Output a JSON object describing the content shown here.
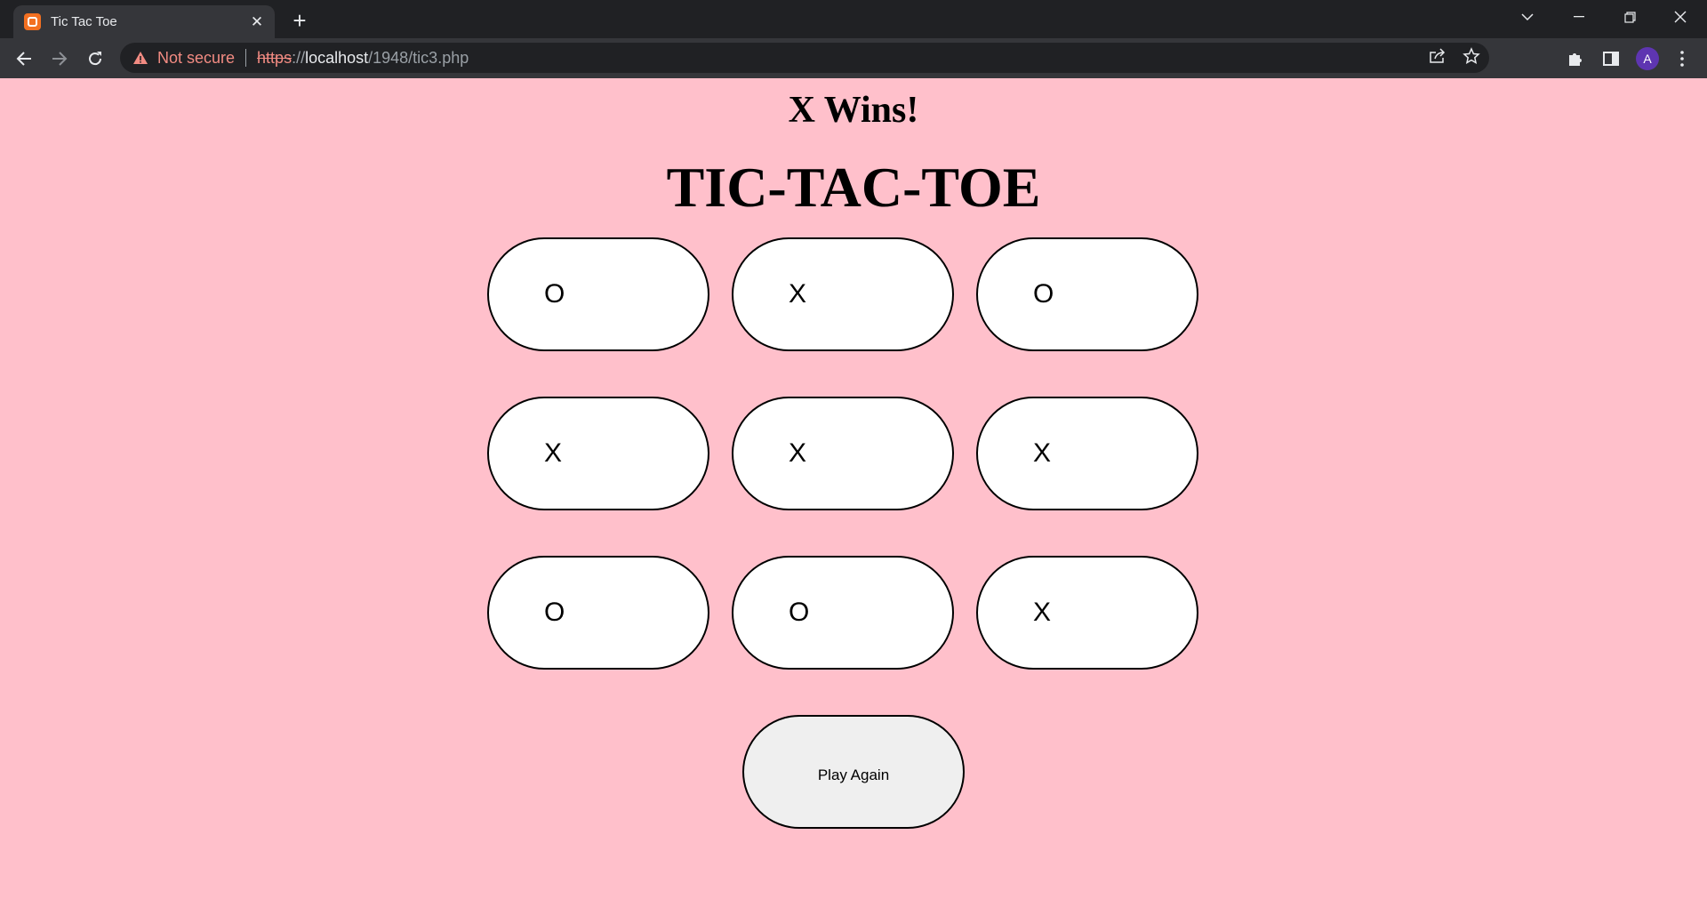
{
  "browser": {
    "tab_title": "Tic Tac Toe",
    "security_label": "Not secure",
    "url_scheme": "https",
    "url_separator": "://",
    "url_host": "localhost",
    "url_path": "/1948/tic3.php",
    "profile_initial": "A"
  },
  "game": {
    "result": "X Wins!",
    "title": "TIC-TAC-TOE",
    "cells": [
      "O",
      "X",
      "O",
      "X",
      "X",
      "X",
      "O",
      "O",
      "X"
    ],
    "play_again_label": "Play Again"
  },
  "colors": {
    "page_background": "#ffc0cb",
    "cell_background": "#ffffff",
    "button_background": "#efefef"
  }
}
